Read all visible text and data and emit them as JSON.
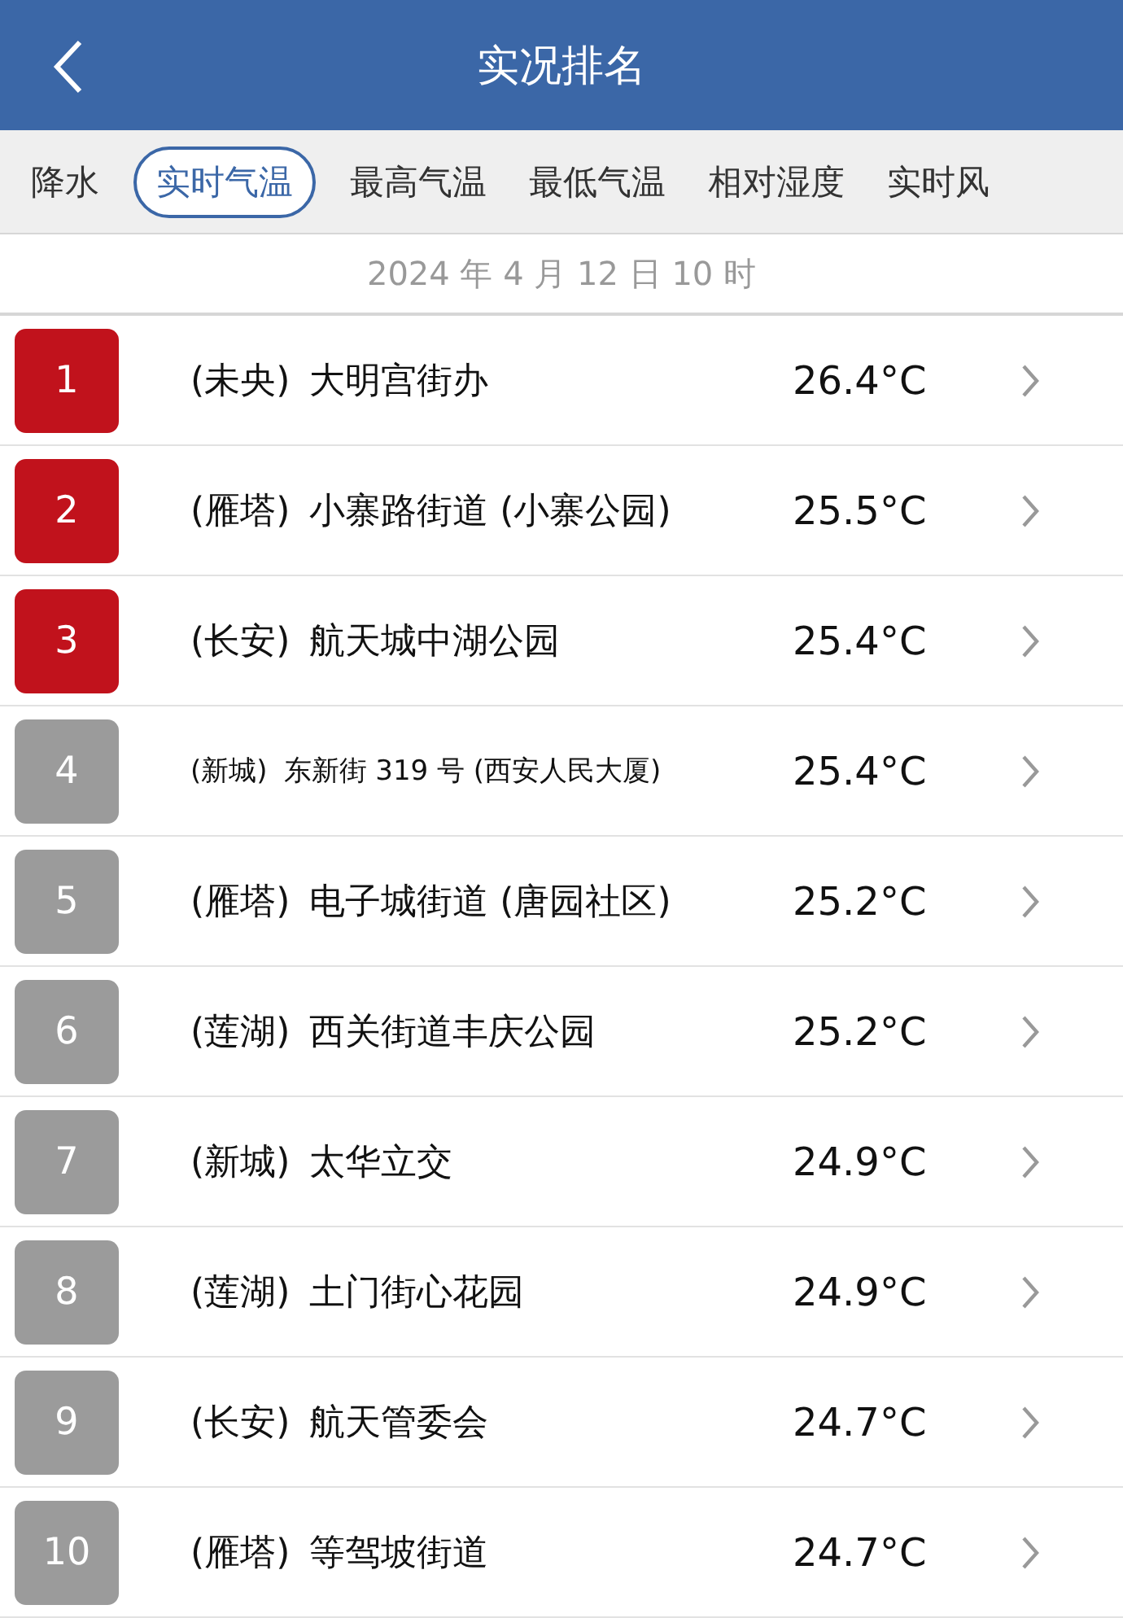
{
  "header": {
    "title": "实况排名"
  },
  "tabs": [
    {
      "label": "降水",
      "selected": false
    },
    {
      "label": "实时气温",
      "selected": true
    },
    {
      "label": "最高气温",
      "selected": false
    },
    {
      "label": "最低气温",
      "selected": false
    },
    {
      "label": "相对湿度",
      "selected": false
    },
    {
      "label": "实时风",
      "selected": false
    }
  ],
  "date": "2024 年 4 月 12 日 10 时",
  "rows": [
    {
      "rank": "1",
      "color": "#c1121c",
      "district": "(未央)",
      "station": "大明宫街办",
      "temperature": "26.4°C"
    },
    {
      "rank": "2",
      "color": "#c1121c",
      "district": "(雁塔)",
      "station": "小寨路街道 (小寨公园)",
      "temperature": "25.5°C"
    },
    {
      "rank": "3",
      "color": "#c1121c",
      "district": "(长安)",
      "station": "航天城中湖公园",
      "temperature": "25.4°C"
    },
    {
      "rank": "4",
      "color": "#9b9b9b",
      "district": "(新城)",
      "station": "东新街 319 号 (西安人民大厦)",
      "temperature": "25.4°C"
    },
    {
      "rank": "5",
      "color": "#9b9b9b",
      "district": "(雁塔)",
      "station": "电子城街道 (唐园社区)",
      "temperature": "25.2°C"
    },
    {
      "rank": "6",
      "color": "#9b9b9b",
      "district": "(莲湖)",
      "station": "西关街道丰庆公园",
      "temperature": "25.2°C"
    },
    {
      "rank": "7",
      "color": "#9b9b9b",
      "district": "(新城)",
      "station": "太华立交",
      "temperature": "24.9°C"
    },
    {
      "rank": "8",
      "color": "#9b9b9b",
      "district": "(莲湖)",
      "station": "土门街心花园",
      "temperature": "24.9°C"
    },
    {
      "rank": "9",
      "color": "#9b9b9b",
      "district": "(长安)",
      "station": "航天管委会",
      "temperature": "24.7°C"
    },
    {
      "rank": "10",
      "color": "#9b9b9b",
      "district": "(雁塔)",
      "station": "等驾坡街道",
      "temperature": "24.7°C"
    }
  ]
}
